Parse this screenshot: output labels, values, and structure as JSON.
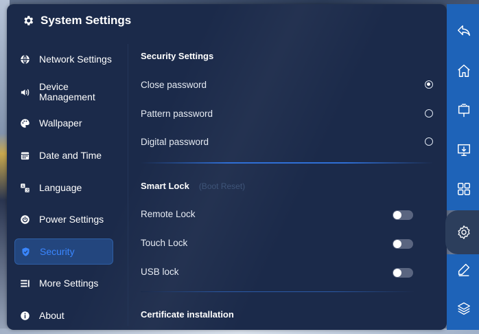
{
  "window": {
    "title": "System Settings",
    "icon": "gear-icon"
  },
  "sidebar": {
    "items": [
      {
        "label": "Network Settings",
        "icon": "globe-icon"
      },
      {
        "label": "Device Management",
        "icon": "speaker-icon"
      },
      {
        "label": "Wallpaper",
        "icon": "palette-icon"
      },
      {
        "label": "Date and Time",
        "icon": "calendar-icon"
      },
      {
        "label": "Language",
        "icon": "language-icon"
      },
      {
        "label": "Power Settings",
        "icon": "power-icon"
      },
      {
        "label": "Security",
        "icon": "shield-icon",
        "active": true
      },
      {
        "label": "More Settings",
        "icon": "list-icon"
      },
      {
        "label": "About",
        "icon": "info-icon"
      }
    ]
  },
  "security": {
    "heading": "Security Settings",
    "options": [
      {
        "label": "Close password",
        "selected": true
      },
      {
        "label": "Pattern password",
        "selected": false
      },
      {
        "label": "Digital password",
        "selected": false
      }
    ]
  },
  "smart_lock": {
    "heading": "Smart Lock",
    "note": "(Boot Reset)",
    "toggles": [
      {
        "label": "Remote Lock",
        "on": false
      },
      {
        "label": "Touch Lock",
        "on": false
      },
      {
        "label": "USB lock",
        "on": false
      }
    ]
  },
  "certificate": {
    "heading": "Certificate installation"
  },
  "rightbar": {
    "icons": [
      "back-icon",
      "home-icon",
      "whiteboard-icon",
      "screen-share-icon",
      "apps-grid-icon",
      "settings-icon",
      "pen-icon",
      "layers-icon"
    ],
    "active": "settings-icon"
  },
  "colors": {
    "panel": "#1b2a4a",
    "accent": "#2f6fd6",
    "rightbar": "#1e63b8",
    "active_text": "#3a86ff"
  }
}
